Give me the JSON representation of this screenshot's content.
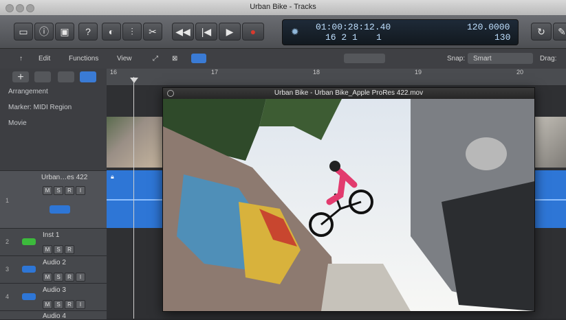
{
  "window": {
    "title": "Urban Bike - Tracks"
  },
  "control_bar": {
    "lcd": {
      "time": "01:00:28:12.40",
      "bar_beat": "16 2 1",
      "bar_sub": "1",
      "tempo": "120.0000",
      "tempo_sub": "130"
    }
  },
  "toolbar": {
    "edit": "Edit",
    "functions": "Functions",
    "view": "View",
    "snap_label": "Snap:",
    "snap_value": "Smart",
    "drag_label": "Drag:"
  },
  "global_tracks": {
    "arrangement": "Arrangement",
    "marker": "Marker: MIDI Region",
    "movie": "Movie"
  },
  "ruler": {
    "marks": [
      "16",
      "17",
      "18",
      "19",
      "20"
    ]
  },
  "tracks": [
    {
      "num": "1",
      "name": "Urban…es 422",
      "buttons": [
        "M",
        "S",
        "R",
        "I"
      ]
    },
    {
      "num": "2",
      "name": "Inst 1",
      "buttons": [
        "M",
        "S",
        "R"
      ]
    },
    {
      "num": "3",
      "name": "Audio 2",
      "buttons": [
        "M",
        "S",
        "R",
        "I"
      ]
    },
    {
      "num": "4",
      "name": "Audio 3",
      "buttons": [
        "M",
        "S",
        "R",
        "I"
      ]
    },
    {
      "num": "",
      "name": "Audio 4",
      "buttons": []
    }
  ],
  "movie_window": {
    "title": "Urban Bike - Urban Bike_Apple ProRes 422.mov"
  },
  "colors": {
    "region_blue": "#2e76d6",
    "lcd_text": "#bfe0ff",
    "record_red": "#d83a2e"
  }
}
